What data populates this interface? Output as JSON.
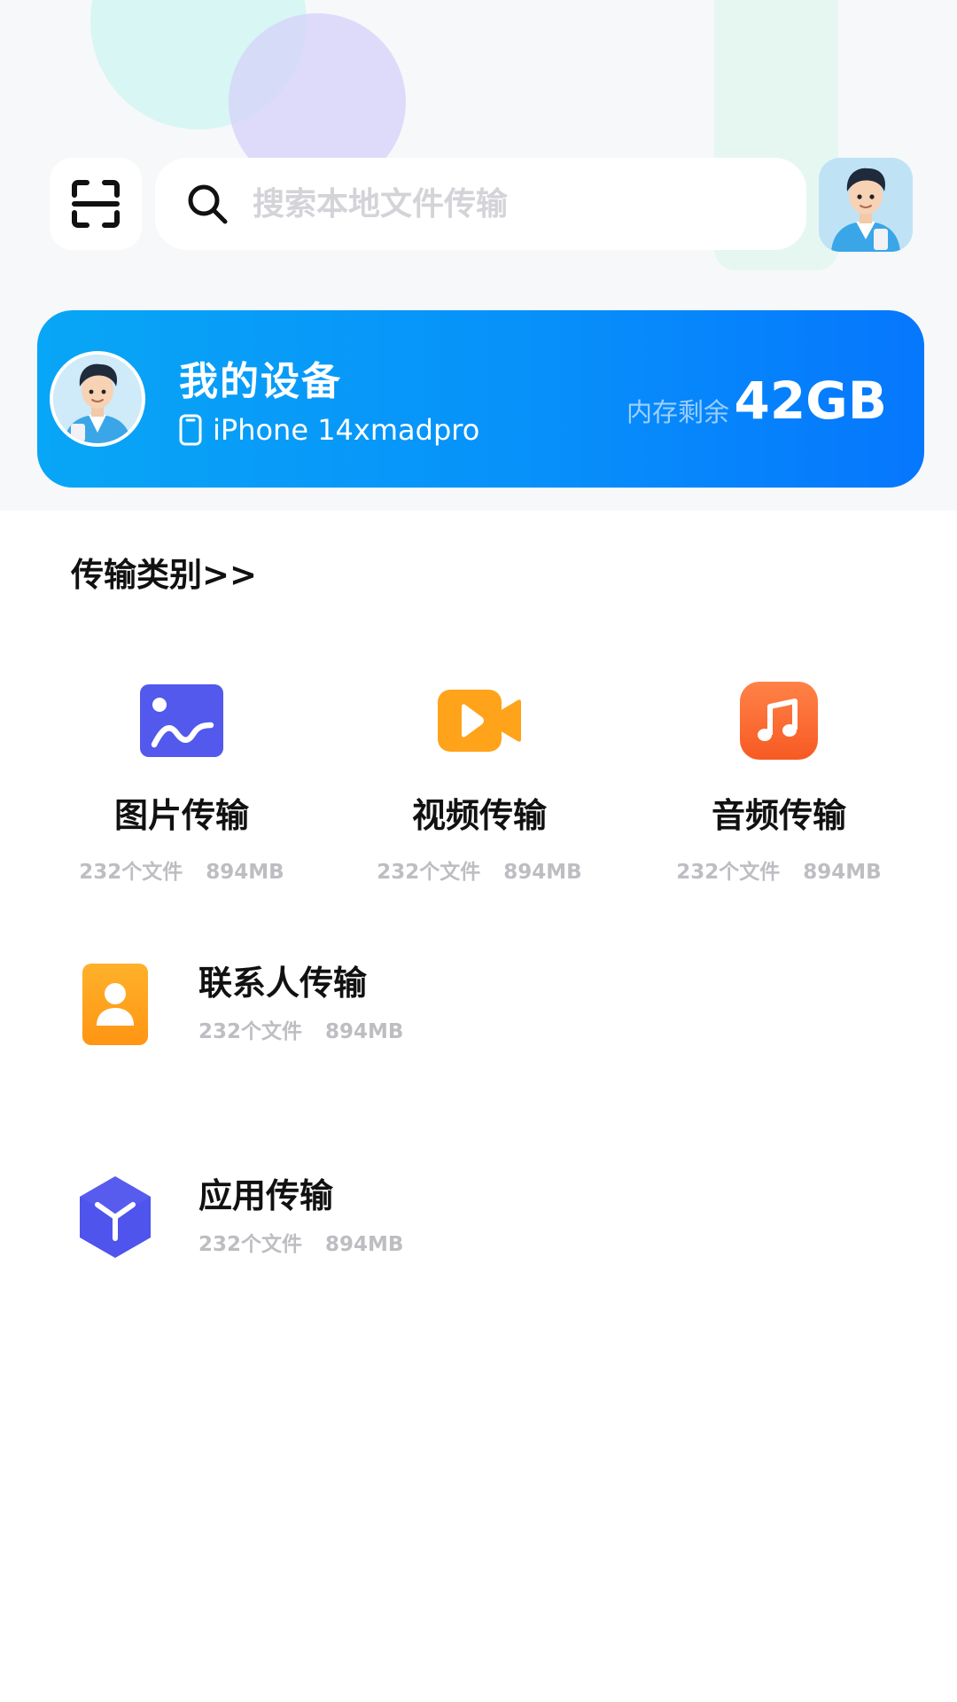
{
  "search": {
    "placeholder": "搜索本地文件传输"
  },
  "device_card": {
    "title": "我的设备",
    "model": "iPhone 14xmadpro",
    "storage_label": "内存剩余",
    "storage_value": "42GB"
  },
  "section": {
    "title": "传输类别>>"
  },
  "categories": [
    {
      "name": "图片传输",
      "count": "232个文件",
      "size": "894MB",
      "icon": "image-icon",
      "color": "#5259ec"
    },
    {
      "name": "视频传输",
      "count": "232个文件",
      "size": "894MB",
      "icon": "video-icon",
      "color": "#ffa31a"
    },
    {
      "name": "音频传输",
      "count": "232个文件",
      "size": "894MB",
      "icon": "music-icon",
      "color": "#fa6a2e"
    }
  ],
  "list": [
    {
      "name": "联系人传输",
      "count": "232个文件",
      "size": "894MB",
      "icon": "contact-icon",
      "color": "#ffa51c"
    },
    {
      "name": "应用传输",
      "count": "232个文件",
      "size": "894MB",
      "icon": "app-cube-icon",
      "color": "#4e54ec"
    }
  ],
  "colors": {
    "accent": "#0791fa",
    "background": "#f7f8fa",
    "muted_text": "#bdbdc2"
  }
}
